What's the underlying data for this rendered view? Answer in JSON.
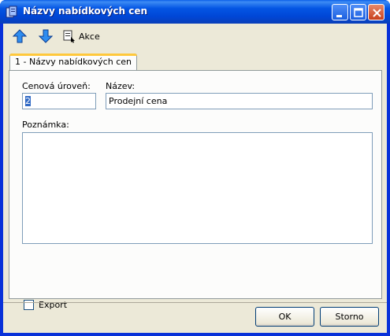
{
  "window": {
    "title": "Názvy nabídkových cen"
  },
  "toolbar": {
    "move_up_icon": "arrow-up-icon",
    "move_down_icon": "arrow-down-icon",
    "actions_label": "Akce"
  },
  "tabs": [
    {
      "label": "1 - Názvy nabídkových cen",
      "active": true
    }
  ],
  "form": {
    "price_level": {
      "label": "Cenová úroveň:",
      "value": "2"
    },
    "name": {
      "label": "Název:",
      "value": "Prodejní cena"
    },
    "note": {
      "label": "Poznámka:",
      "value": ""
    },
    "export": {
      "label": "Export",
      "checked": false
    }
  },
  "buttons": {
    "ok_label": "OK",
    "cancel_label": "Storno"
  },
  "colors": {
    "titlebar": "#0054e3",
    "dialog_bg": "#ece9d8",
    "selection": "#316ac5",
    "close_button": "#c8401c"
  }
}
